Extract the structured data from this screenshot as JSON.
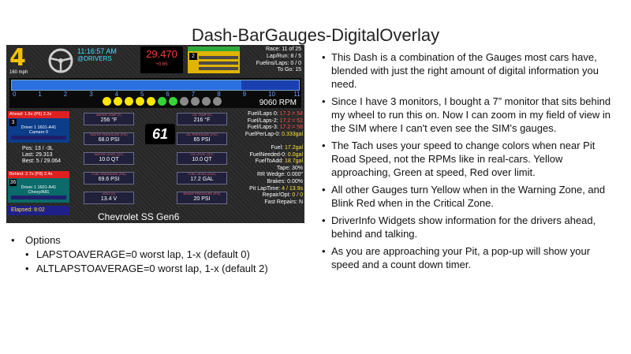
{
  "title": "Dash-BarGauges-DigitalOverlay",
  "dash": {
    "gear": "4",
    "speed": "160 mph",
    "clock": "11:16:57 AM",
    "drivers_tag": "@DRIVERS",
    "fuel_value": "29.470",
    "fuel_delta": "+0.65",
    "pit_badge": "2",
    "race_lines": [
      "Race: 11 of 25",
      "Lap/Run: 8 / 5",
      "Fuelins/Laps: 0 / 0",
      "To Go: 15"
    ],
    "tach_ticks": [
      "0",
      "1",
      "2",
      "3",
      "4",
      "5",
      "6",
      "7",
      "8",
      "9",
      "10",
      "11"
    ],
    "rpm": "9060 RPM",
    "rpm_fill_fraction": 0.8,
    "shift_lights": [
      "#ffe600",
      "#ffe600",
      "#ffe600",
      "#ffe600",
      "#ffe600",
      "#36d436",
      "#36d436",
      "#8a8a8a",
      "#8a8a8a",
      "#8a8a8a",
      "#8a8a8a"
    ],
    "driver_ahead": {
      "header": "Ahead: 1.9s (P6) 2.2s",
      "num": "3",
      "name": "Driver 1  1601-A41",
      "team": "Camaro 0"
    },
    "stats": {
      "pos": "Pos: 13 / -3L",
      "last": "Last: 29.313",
      "best": "Best: 5 / 29.064"
    },
    "driver_behind": {
      "header": "Behind: 2.7s (P8) 2.4s",
      "num": "36",
      "name": "Driver 1  1601-A41",
      "team": "Chevy/A81"
    },
    "elapsed": "Elapsed: 8:02",
    "lap_number": "61",
    "gauges": [
      {
        "label": "WATER TEMP (F)",
        "value": "256 °F"
      },
      {
        "label": "OIL TEMP (F)",
        "value": "216 °F"
      },
      {
        "label": "WATER PRESSURE (PSI)",
        "value": "68.0 PSI"
      },
      {
        "label": "OIL PRESSURE (PSI)",
        "value": "65 PSI"
      },
      {
        "label": "WATER LEVEL (QT)",
        "value": "10.0 QT"
      },
      {
        "label": "OIL LEVEL (QT)",
        "value": "10.0 QT"
      },
      {
        "label": "FUEL PRESSURE (PSI)",
        "value": "69.6 PSI"
      },
      {
        "label": "FUEL LEVEL (GAL)",
        "value": "17.2 GAL"
      },
      {
        "label": "VOLT (V)",
        "value": "13.4 V"
      },
      {
        "label": "BRAKE PRESSURE (PSI)",
        "value": "20 PSI"
      }
    ],
    "info_lines": [
      {
        "label": "Fuel/Laps 0:",
        "value": "17.2 = 54",
        "cls": "r"
      },
      {
        "label": "Fuel/Laps-2:",
        "value": "17.2 = 52",
        "cls": "r"
      },
      {
        "label": "Fuel/Laps-3:",
        "value": "17.2 = 58",
        "cls": "r"
      },
      {
        "label": "FuelPerLap-0:",
        "value": "0.333gal",
        "cls": "y"
      },
      {
        "label": "",
        "value": "",
        "cls": ""
      },
      {
        "label": "Fuel:",
        "value": "17.2gal",
        "cls": "y"
      },
      {
        "label": "FuelNeeded-0:",
        "value": "0.0gal",
        "cls": "y"
      },
      {
        "label": "FuelToAdd:",
        "value": "18.7gal",
        "cls": "y"
      },
      {
        "label": "Tape:",
        "value": "30%",
        "cls": ""
      },
      {
        "label": "RR Wedge:",
        "value": "0.000\"",
        "cls": ""
      },
      {
        "label": "Brakes:",
        "value": "0.00%",
        "cls": ""
      },
      {
        "label": "Pit LapTime:",
        "value": "4 / 13.9s",
        "cls": "y"
      },
      {
        "label": "Repair/Opt:",
        "value": "0 / 0",
        "cls": "y"
      },
      {
        "label": "Fast Repairs:",
        "value": "N",
        "cls": ""
      }
    ],
    "car_name": "Chevrolet SS Gen6"
  },
  "options": {
    "heading": "Options",
    "items": [
      "LAPSTOAVERAGE=0 worst lap, 1-x (default 0)",
      "ALTLAPSTOAVERAGE=0 worst lap, 1-x (default 2)"
    ]
  },
  "bullets": [
    "This Dash is a combination of the Gauges most cars have, blended with just the right amount of digital information you need.",
    "Since I have 3 monitors, I bought a 7” monitor that sits behind my wheel to run this on. Now I can zoom in my field of view in the SIM where I can't even see the SIM's gauges.",
    "The Tach uses your speed to change colors when near Pit Road Speed, not the RPMs like in real-cars. Yellow approaching, Green at speed, Red over limit.",
    "All other Gauges turn Yellow when in the Warning Zone, and Blink Red when in the Critical Zone.",
    "DriverInfo Widgets show information for the drivers ahead, behind and talking.",
    "As you are approaching your Pit, a pop-up will show your speed and a count down timer."
  ]
}
